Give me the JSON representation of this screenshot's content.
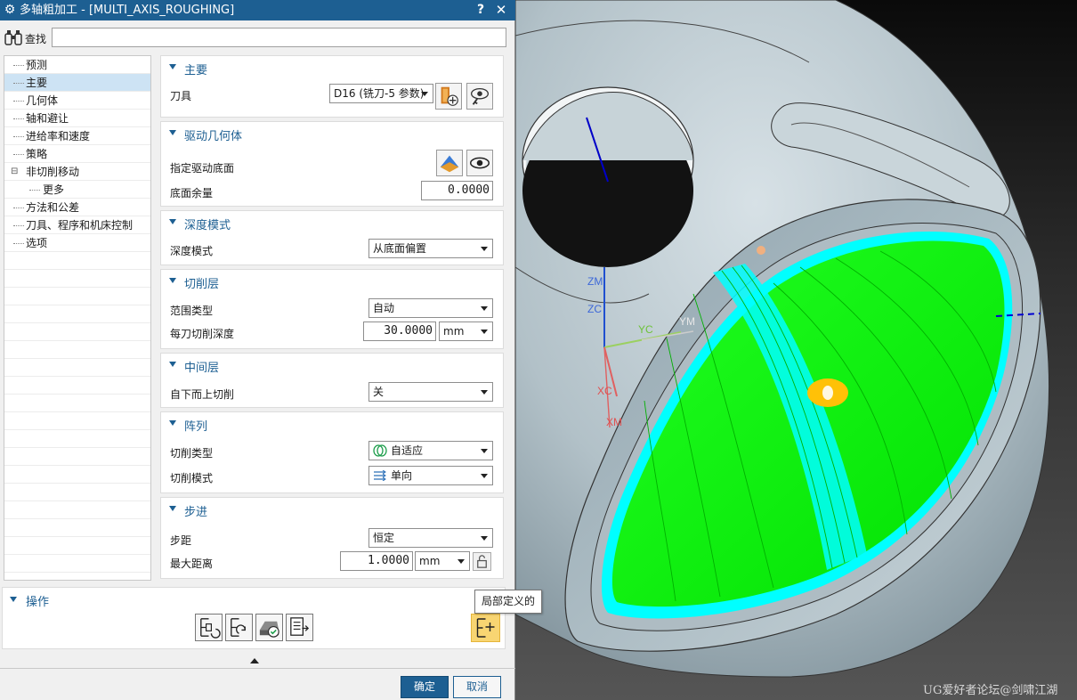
{
  "dialog": {
    "title": "多轴粗加工 - [MULTI_AXIS_ROUGHING]",
    "help_glyph": "?",
    "close_glyph": "✕",
    "search_label": "查找",
    "search_value": ""
  },
  "tree": {
    "items": [
      {
        "label": "预测"
      },
      {
        "label": "主要"
      },
      {
        "label": "几何体"
      },
      {
        "label": "轴和避让"
      },
      {
        "label": "进给率和速度"
      },
      {
        "label": "策略"
      },
      {
        "label": "非切削移动"
      },
      {
        "label": "更多"
      },
      {
        "label": "方法和公差"
      },
      {
        "label": "刀具、程序和机床控制"
      },
      {
        "label": "选项"
      }
    ],
    "selected": "主要"
  },
  "sections": {
    "main": {
      "title": "主要",
      "tool_label": "刀具",
      "tool_value": "D16 (铣刀-5 参数)"
    },
    "drive": {
      "title": "驱动几何体",
      "spec_label": "指定驱动底面",
      "allow_label": "底面余量",
      "allow_value": "0.0000"
    },
    "depth": {
      "title": "深度模式",
      "mode_label": "深度模式",
      "mode_value": "从底面偏置"
    },
    "cutlevel": {
      "title": "切削层",
      "range_label": "范围类型",
      "range_value": "自动",
      "depth_label": "每刀切削深度",
      "depth_value": "30.0000",
      "depth_unit": "mm"
    },
    "mid": {
      "title": "中间层",
      "bottomup_label": "自下而上切削",
      "bottomup_value": "关"
    },
    "pattern": {
      "title": "阵列",
      "type_label": "切削类型",
      "type_value": "自适应",
      "mode_label": "切削模式",
      "mode_value": "单向"
    },
    "stepover": {
      "title": "步进",
      "step_label": "步距",
      "step_value": "恒定",
      "max_label": "最大距离",
      "max_value": "1.0000",
      "max_unit": "mm"
    }
  },
  "ops": {
    "title": "操作",
    "tooltip": "局部定义的"
  },
  "buttons": {
    "ok": "确定",
    "cancel": "取消"
  },
  "viewport": {
    "axis_labels": {
      "zm": "ZM",
      "zc": "ZC",
      "yc": "YC",
      "ym": "YM",
      "xc": "XC",
      "xm": "XM"
    },
    "watermark": "UG爱好者论坛@剑啸江湖"
  },
  "colors": {
    "title_blue": "#1d5f92",
    "toolpath_green": "#00ff00",
    "toolpath_cyan": "#00ffff",
    "part_gray": "#b8c6cc",
    "highlight_yellow": "#f8d572"
  }
}
